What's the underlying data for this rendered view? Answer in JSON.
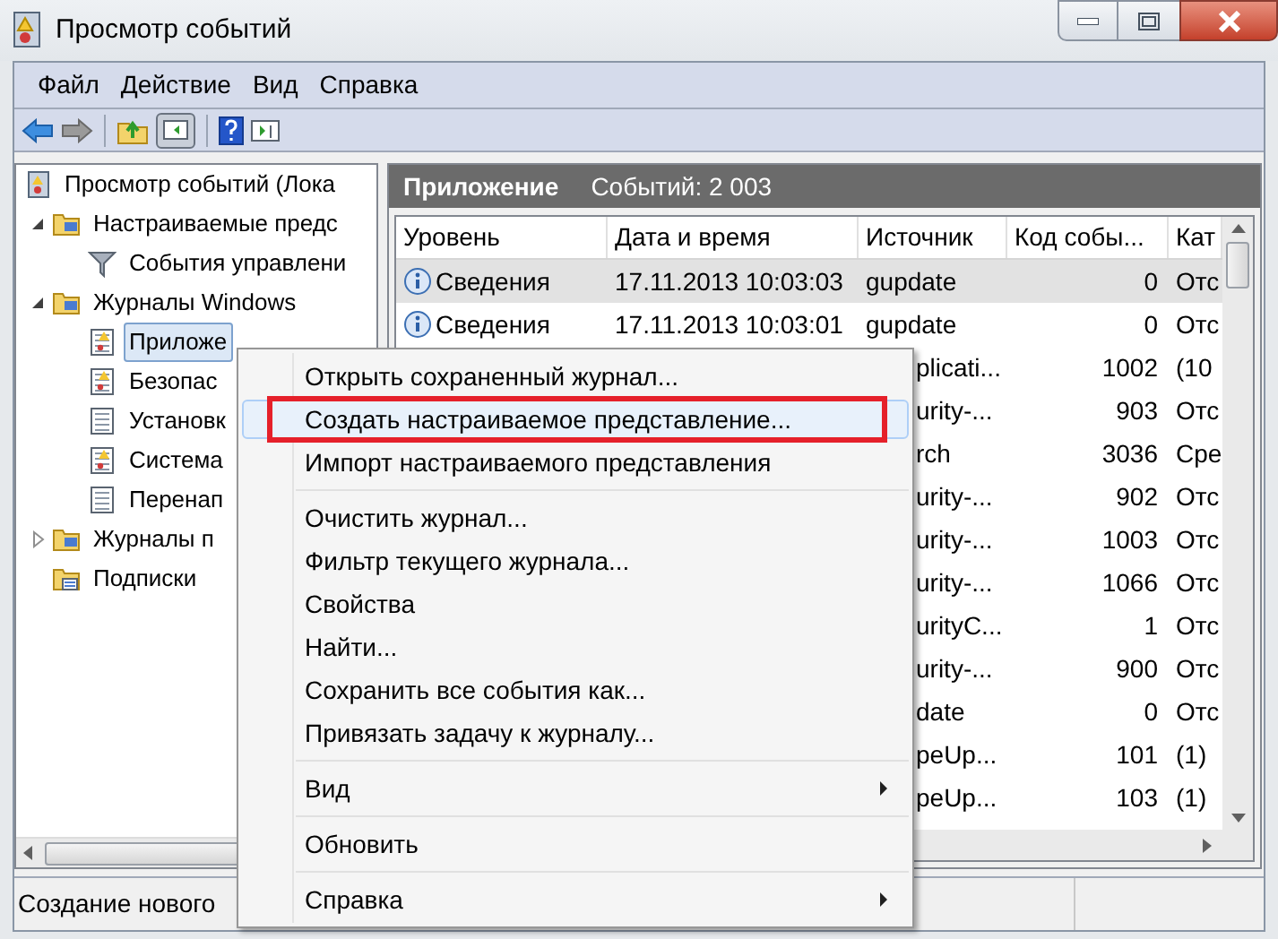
{
  "window": {
    "title": "Просмотр событий"
  },
  "menu_bar": [
    "Файл",
    "Действие",
    "Вид",
    "Справка"
  ],
  "tree": [
    {
      "label": "Просмотр событий (Лока",
      "kind": "viewer",
      "selected": false,
      "children": [
        {
          "label": "Настраиваемые предс",
          "kind": "folder",
          "expanded": true,
          "selected": false,
          "children": [
            {
              "label": "События управлени",
              "kind": "filter",
              "selected": false
            }
          ]
        },
        {
          "label": "Журналы Windows",
          "kind": "folder",
          "expanded": true,
          "selected": false,
          "children": [
            {
              "label": "Приложе",
              "kind": "log",
              "selected": true
            },
            {
              "label": "Безопас",
              "kind": "log",
              "selected": false
            },
            {
              "label": "Установк",
              "kind": "plain",
              "selected": false
            },
            {
              "label": "Система",
              "kind": "log",
              "selected": false
            },
            {
              "label": "Перенап",
              "kind": "plain",
              "selected": false
            }
          ]
        },
        {
          "label": "Журналы п",
          "kind": "folder",
          "expanded": false,
          "selected": false
        },
        {
          "label": "Подписки",
          "kind": "subs",
          "selected": false
        }
      ]
    }
  ],
  "panel": {
    "title": "Приложение",
    "count": "Событий: 2 003"
  },
  "table": {
    "columns": [
      "Уровень",
      "Дата и время",
      "Источник",
      "Код собы...",
      "Кат"
    ],
    "rows": [
      {
        "kind": "full",
        "selected": true,
        "level": "Сведения",
        "date": "17.11.2013 10:03:03",
        "source": "gupdate",
        "code": "0",
        "category": "Отс"
      },
      {
        "kind": "full",
        "selected": false,
        "level": "Сведения",
        "date": "17.11.2013 10:03:01",
        "source": "gupdate",
        "code": "0",
        "category": "Отс"
      },
      {
        "kind": "covered",
        "selected": false,
        "source": "plicati...",
        "code": "1002",
        "category": "(10"
      },
      {
        "kind": "covered",
        "selected": false,
        "source": "urity-...",
        "code": "903",
        "category": "Отс"
      },
      {
        "kind": "covered",
        "selected": false,
        "source": "rch",
        "code": "3036",
        "category": "Сре"
      },
      {
        "kind": "covered",
        "selected": false,
        "source": "urity-...",
        "code": "902",
        "category": "Отс"
      },
      {
        "kind": "covered",
        "selected": false,
        "source": "urity-...",
        "code": "1003",
        "category": "Отс"
      },
      {
        "kind": "covered",
        "selected": false,
        "source": "urity-...",
        "code": "1066",
        "category": "Отс"
      },
      {
        "kind": "covered",
        "selected": false,
        "source": "urityC...",
        "code": "1",
        "category": "Отс"
      },
      {
        "kind": "covered",
        "selected": false,
        "source": "urity-...",
        "code": "900",
        "category": "Отс"
      },
      {
        "kind": "covered",
        "selected": false,
        "source": "date",
        "code": "0",
        "category": "Отс"
      },
      {
        "kind": "covered",
        "selected": false,
        "source": "peUp...",
        "code": "101",
        "category": "(1)"
      },
      {
        "kind": "covered",
        "selected": false,
        "source": "peUp...",
        "code": "103",
        "category": "(1)"
      }
    ]
  },
  "status_bar": "Создание нового",
  "context_menu": [
    {
      "kind": "item",
      "label": "Открыть сохраненный журнал...",
      "selected": false,
      "annotated": false
    },
    {
      "kind": "item",
      "label": "Создать настраиваемое представление...",
      "selected": true,
      "annotated": true
    },
    {
      "kind": "item",
      "label": "Импорт настраиваемого представления",
      "selected": false,
      "annotated": false
    },
    {
      "kind": "separator"
    },
    {
      "kind": "item",
      "label": "Очистить журнал...",
      "selected": false,
      "annotated": false
    },
    {
      "kind": "item",
      "label": "Фильтр текущего журнала...",
      "selected": false,
      "annotated": false
    },
    {
      "kind": "item",
      "label": "Свойства",
      "selected": false,
      "annotated": false
    },
    {
      "kind": "item",
      "label": "Найти...",
      "selected": false,
      "annotated": false
    },
    {
      "kind": "item",
      "label": "Сохранить все события как...",
      "selected": false,
      "annotated": false
    },
    {
      "kind": "item",
      "label": "Привязать задачу к журналу...",
      "selected": false,
      "annotated": false
    },
    {
      "kind": "separator"
    },
    {
      "kind": "submenu",
      "label": "Вид",
      "selected": false,
      "annotated": false
    },
    {
      "kind": "separator"
    },
    {
      "kind": "item",
      "label": "Обновить",
      "selected": false,
      "annotated": false
    },
    {
      "kind": "separator"
    },
    {
      "kind": "submenu",
      "label": "Справка",
      "selected": false,
      "annotated": false
    }
  ]
}
